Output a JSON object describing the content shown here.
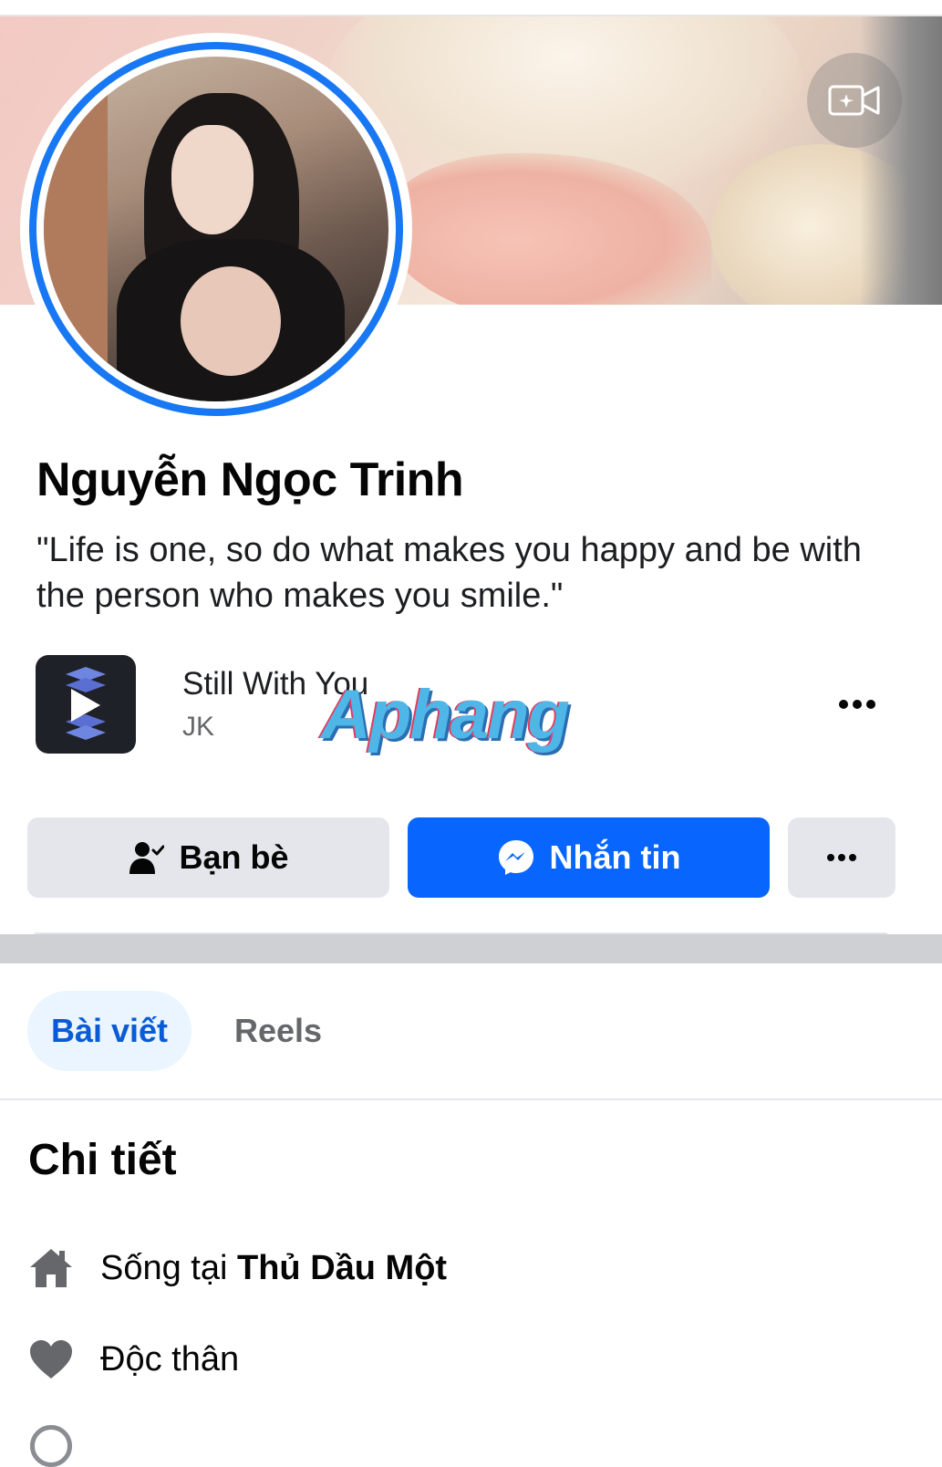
{
  "profile": {
    "name": "Nguyễn Ngọc Trinh",
    "bio": "\"Life is one, so do what makes you happy and be with the person who makes you smile.\""
  },
  "music": {
    "title": "Still With You",
    "artist": "JK",
    "watermark": "Aphang"
  },
  "actions": {
    "friends_label": "Bạn bè",
    "message_label": "Nhắn tin"
  },
  "tabs": [
    {
      "label": "Bài viết",
      "active": true
    },
    {
      "label": "Reels",
      "active": false
    }
  ],
  "details": {
    "title": "Chi tiết",
    "lives_prefix": "Sống tại ",
    "lives_city": "Thủ Dầu Một",
    "relationship": "Độc thân"
  },
  "colors": {
    "accent": "#0866ff",
    "avatar_ring": "#1877f2",
    "tab_active_bg": "#ebf5ff",
    "button_grey": "#e4e6eb"
  },
  "icons": [
    "camera-icon",
    "play-layers-icon",
    "more-dots-icon",
    "friend-check-icon",
    "messenger-icon",
    "home-icon",
    "heart-icon"
  ]
}
